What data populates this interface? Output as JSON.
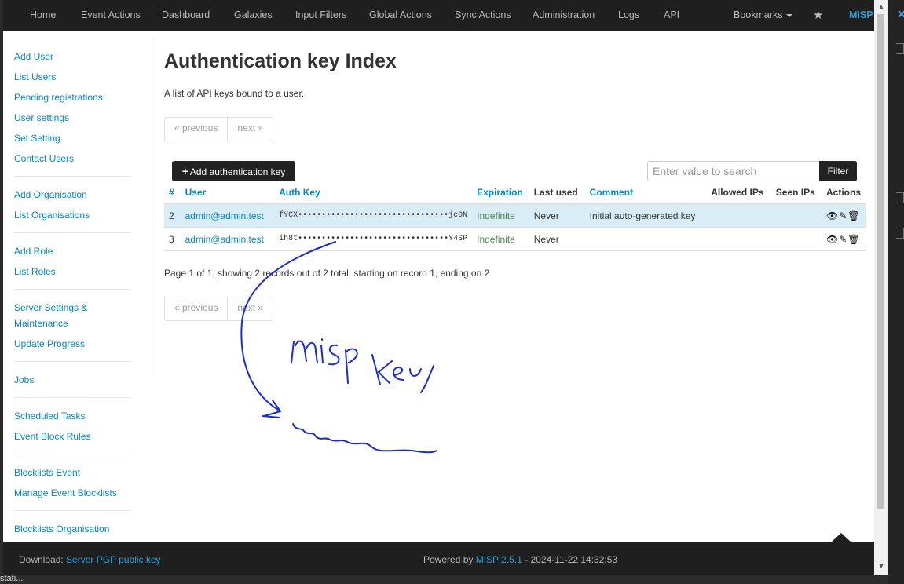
{
  "navbar": {
    "items": [
      "Home",
      "Event Actions",
      "Dashboard",
      "Galaxies",
      "Input Filters",
      "Global Actions",
      "Sync Actions",
      "Administration",
      "Logs",
      "API"
    ],
    "bookmarks": "Bookmarks",
    "brand": "MISP"
  },
  "sidebar": {
    "groups": [
      [
        "Add User",
        "List Users",
        "Pending registrations",
        "User settings",
        "Set Setting",
        "Contact Users"
      ],
      [
        "Add Organisation",
        "List Organisations"
      ],
      [
        "Add Role",
        "List Roles"
      ],
      [
        "Server Settings & Maintenance",
        "Update Progress"
      ],
      [
        "Jobs"
      ],
      [
        "Scheduled Tasks",
        "Event Block Rules"
      ],
      [
        "Blocklists Event",
        "Manage Event Blocklists"
      ],
      [
        "Blocklists Organisation"
      ]
    ]
  },
  "main": {
    "title": "Authentication key Index",
    "subtitle": "A list of API keys bound to a user.",
    "pager_prev": "« previous",
    "pager_next": "next »",
    "add_button": "Add authentication key",
    "search_placeholder": "Enter value to search",
    "filter_button": "Filter",
    "columns": [
      "#",
      "User",
      "Auth Key",
      "Expiration",
      "Last used",
      "Comment",
      "Allowed IPs",
      "Seen IPs",
      "Actions"
    ],
    "rows": [
      {
        "id": "2",
        "user": "admin@admin.test",
        "auth_key": "fYCX••••••••••••••••••••••••••••••••jc0N",
        "expiration": "Indefinite",
        "last_used": "Never",
        "comment": "Initial auto-generated key",
        "allowed_ips": "",
        "seen_ips": ""
      },
      {
        "id": "3",
        "user": "admin@admin.test",
        "auth_key": "ih8t••••••••••••••••••••••••••••••••Y4SP",
        "expiration": "Indefinite",
        "last_used": "Never",
        "comment": "",
        "allowed_ips": "",
        "seen_ips": ""
      }
    ],
    "summary": "Page 1 of 1, showing 2 records out of 2 total, starting on record 1, ending on 2",
    "annotation": "mispkey"
  },
  "footer": {
    "download_label": "Download:",
    "download_link": "Server PGP public key",
    "powered_label": "Powered by",
    "powered_link": "MISP 2.5.1",
    "timestamp": "- 2024-11-22 14:32:53"
  },
  "desktop": {
    "bottom_text": "stati..."
  }
}
